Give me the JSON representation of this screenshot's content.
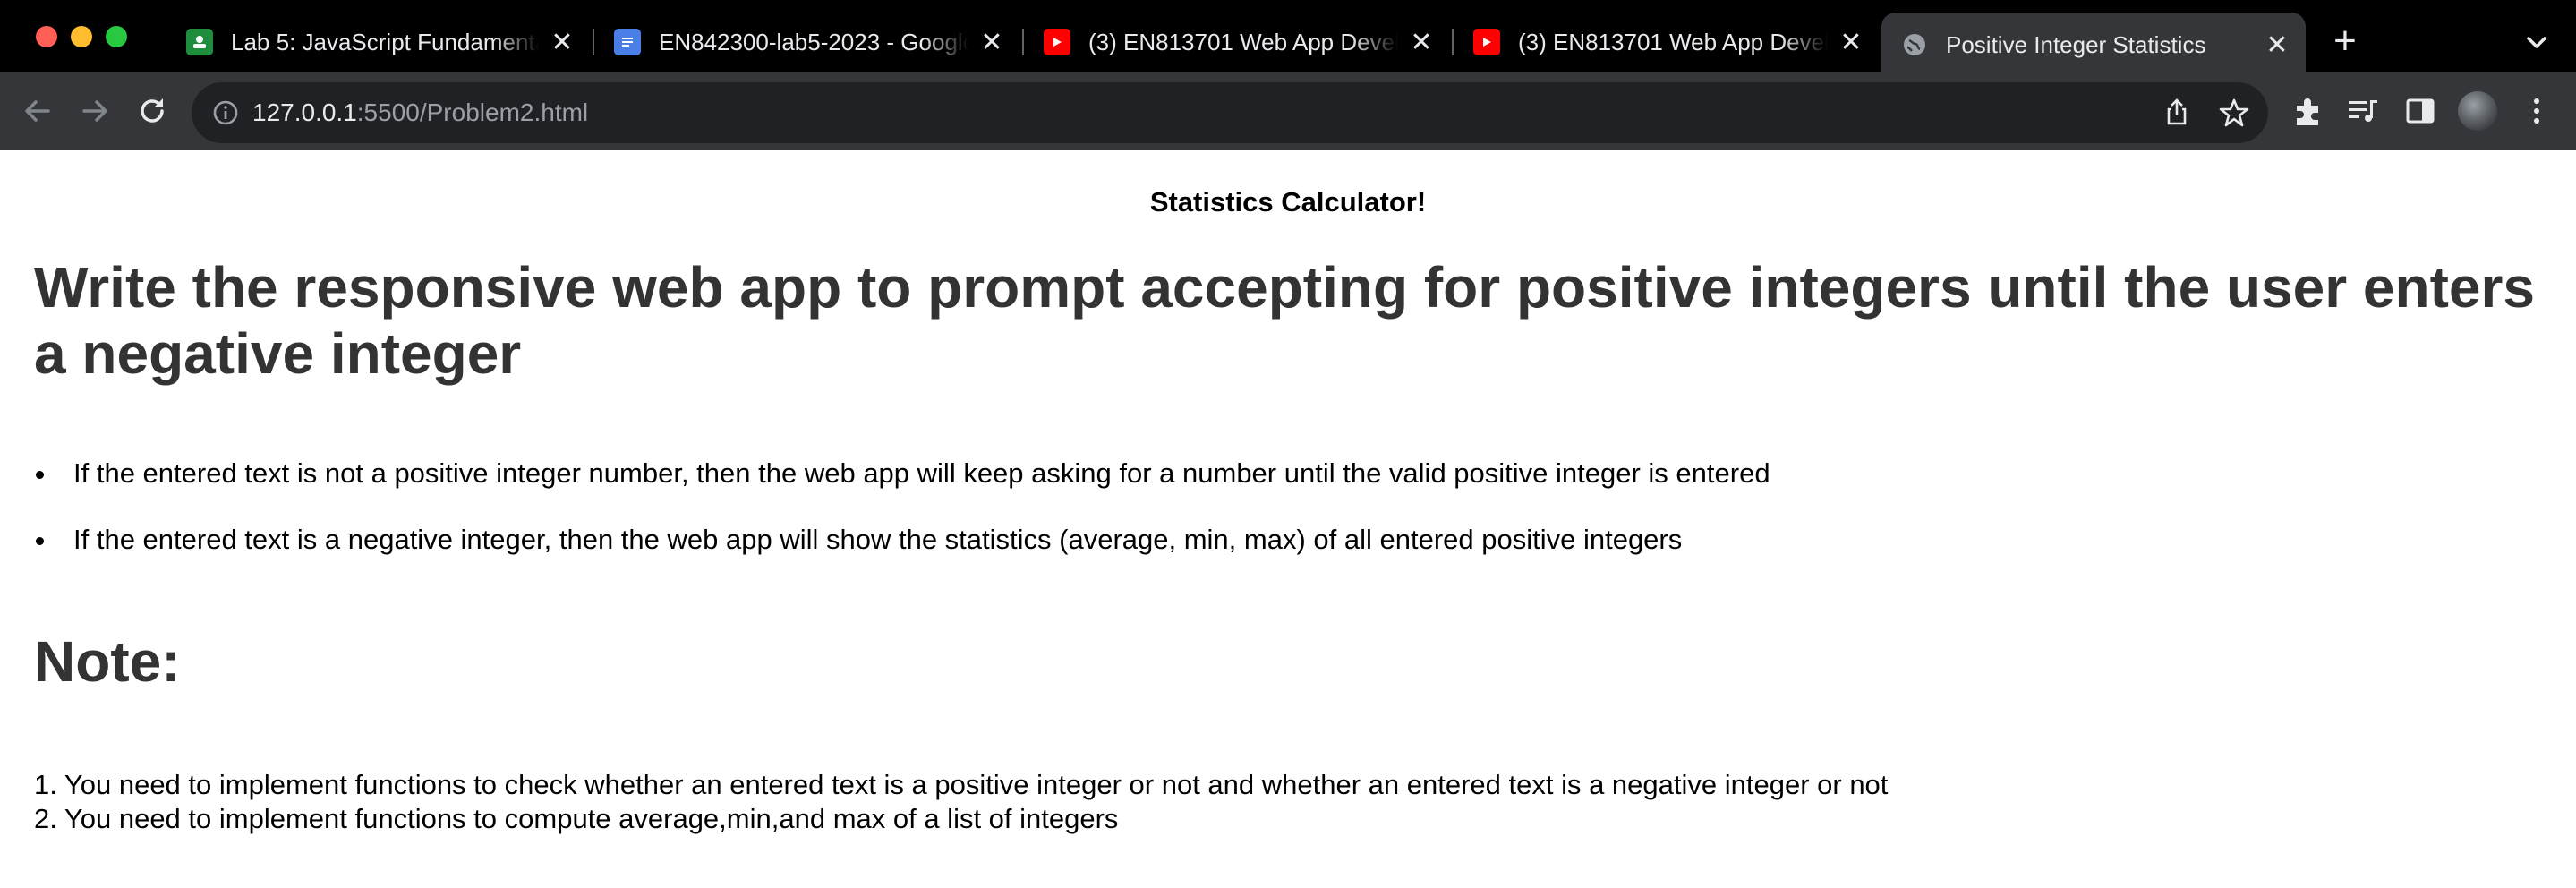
{
  "browser": {
    "tabs": [
      {
        "title": "Lab 5: JavaScript Fundamental",
        "icon": "classroom-icon",
        "active": false
      },
      {
        "title": "EN842300-lab5-2023 - Google",
        "icon": "docs-icon",
        "active": false
      },
      {
        "title": "(3) EN813701 Web App Develop",
        "icon": "youtube-icon",
        "active": false
      },
      {
        "title": "(3) EN813701 Web App Develop",
        "icon": "youtube-icon",
        "active": false
      },
      {
        "title": "Positive Integer Statistics",
        "icon": "globe-icon",
        "active": true
      }
    ],
    "new_tab_label": "+",
    "address": {
      "host": "127.0.0.1",
      "rest": ":5500/Problem2.html"
    }
  },
  "page": {
    "heading": "Statistics Calculator!",
    "main_heading": "Write the responsive web app to prompt accepting for positive integers until the user enters a negative integer",
    "bullets": [
      "If the entered text is not a positive integer number, then the web app will keep asking for a number until the valid positive integer is entered",
      "If the entered text is a negative integer, then the web app will show the statistics (average, min, max) of all entered positive integers"
    ],
    "note_heading": "Note:",
    "note_lines": [
      "1. You need to implement functions to check whether an entered text is a positive integer or not and whether an entered text is a negative integer or not",
      "2. You need to implement functions to compute average,min,and max of a list of integers"
    ]
  },
  "colors": {
    "tabstrip_bg": "#000000",
    "toolbar_bg": "#35363a",
    "omnibox_bg": "#202124",
    "heading_text": "#333333"
  }
}
